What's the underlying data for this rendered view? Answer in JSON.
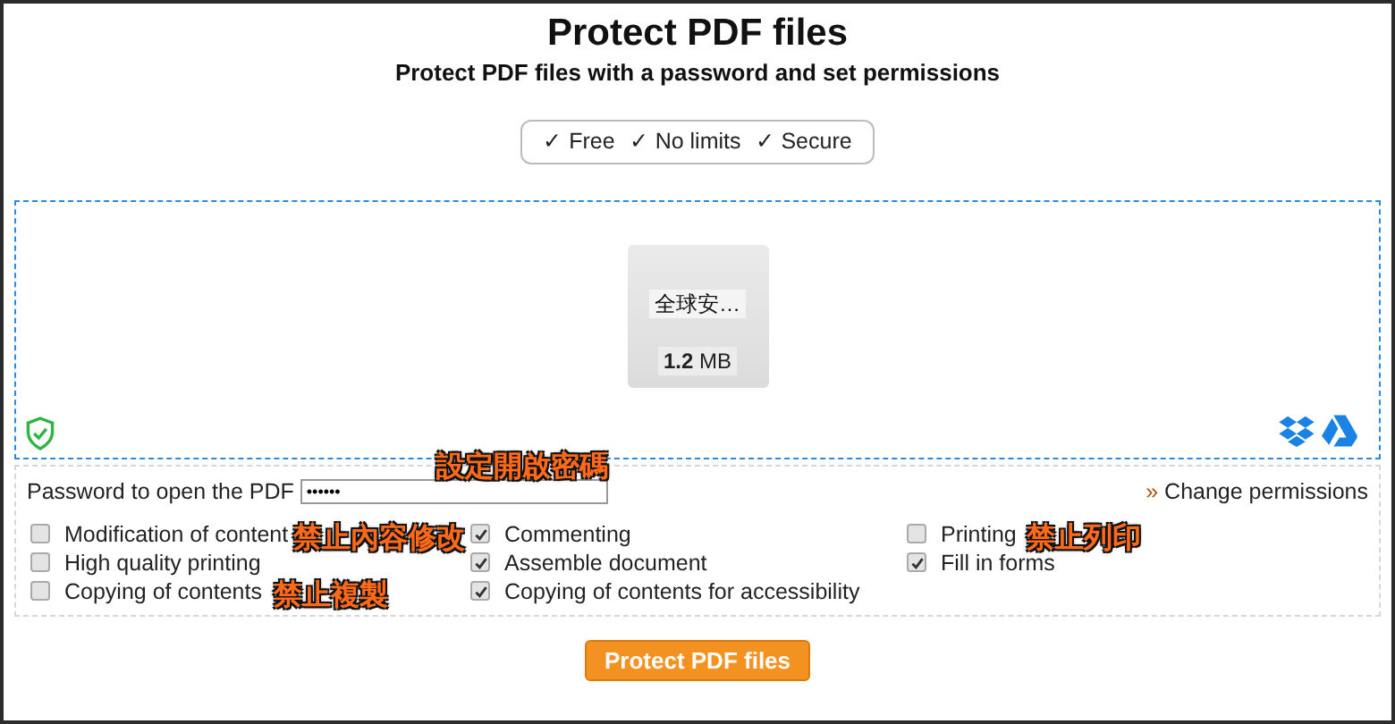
{
  "header": {
    "title": "Protect PDF files",
    "subtitle": "Protect PDF files with a password and set permissions"
  },
  "badges": [
    "✓ Free",
    "✓ No limits",
    "✓ Secure"
  ],
  "file": {
    "name": "全球安…",
    "size_number": "1.2",
    "size_unit": "MB"
  },
  "password": {
    "label": "Password to open the PDF",
    "value": "••••••"
  },
  "change_permissions": {
    "prefix": "»",
    "label": "Change permissions"
  },
  "permissions": [
    [
      {
        "label": "Modification of content",
        "checked": false
      },
      {
        "label": "High quality printing",
        "checked": false
      },
      {
        "label": "Copying of contents",
        "checked": false
      }
    ],
    [
      {
        "label": "Commenting",
        "checked": true
      },
      {
        "label": "Assemble document",
        "checked": true
      },
      {
        "label": "Copying of contents for accessibility",
        "checked": true
      }
    ],
    [
      {
        "label": "Printing",
        "checked": false
      },
      {
        "label": "Fill in forms",
        "checked": true
      }
    ]
  ],
  "submit": "Protect PDF files",
  "annotations": [
    "設定開啟密碼",
    "禁止內容修改",
    "禁止複製",
    "禁止列印"
  ]
}
